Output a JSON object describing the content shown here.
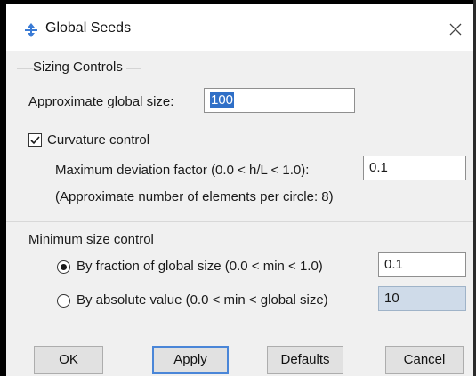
{
  "window": {
    "title": "Global Seeds"
  },
  "sizing_controls": {
    "heading": "Sizing Controls",
    "approx_size_label": "Approximate global size:",
    "approx_size_value": "100"
  },
  "curvature": {
    "label": "Curvature control",
    "checked": true,
    "max_deviation_label": "Maximum deviation factor (0.0 < h/L < 1.0):",
    "max_deviation_value": "0.1",
    "approx_elements_note": "(Approximate number of elements per circle: 8)"
  },
  "min_size_control": {
    "heading": "Minimum size control",
    "by_fraction_label": "By fraction of global size  (0.0 < min < 1.0)",
    "by_fraction_value": "0.1",
    "by_fraction_selected": true,
    "by_absolute_label": "By absolute value  (0.0 < min < global size)",
    "by_absolute_value": "10",
    "by_absolute_selected": false
  },
  "buttons": {
    "ok": "OK",
    "apply": "Apply",
    "defaults": "Defaults",
    "cancel": "Cancel"
  },
  "icons": {
    "app": "seed-mesh-icon",
    "close": "close-icon"
  }
}
